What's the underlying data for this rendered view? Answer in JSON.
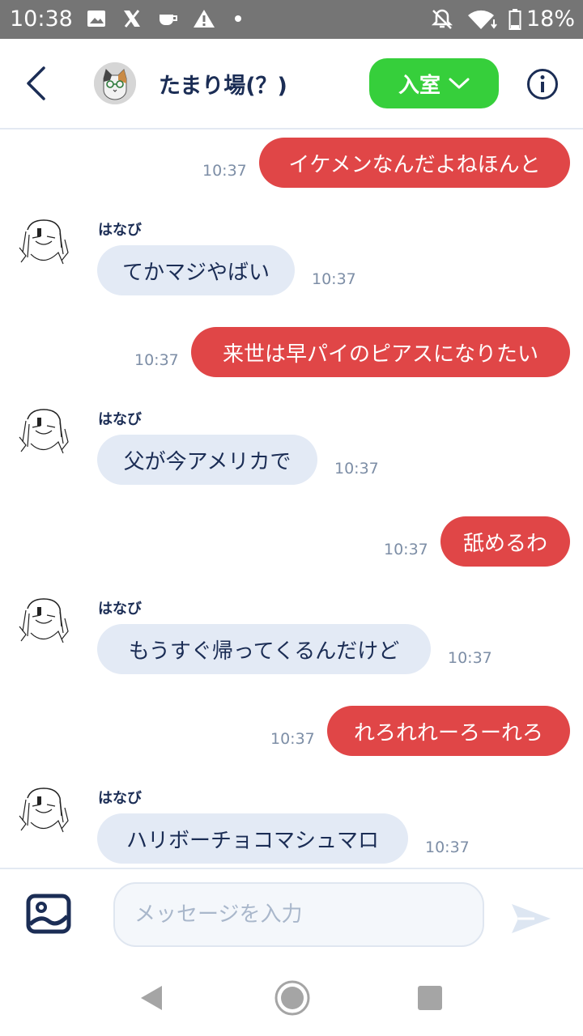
{
  "status_bar": {
    "time": "10:38",
    "battery": "18%"
  },
  "header": {
    "room_title": "たまり場(？)",
    "enter_button": "入室"
  },
  "messages": [
    {
      "side": "me",
      "text": "イケメンなんだよねほんと",
      "time": "10:37"
    },
    {
      "side": "other",
      "sender": "はなび",
      "text": "てかマジやばい",
      "time": "10:37"
    },
    {
      "side": "me",
      "text": "来世は早パイのピアスになりたい",
      "time": "10:37"
    },
    {
      "side": "other",
      "sender": "はなび",
      "text": "父が今アメリカで",
      "time": "10:37"
    },
    {
      "side": "me",
      "text": "舐めるわ",
      "time": "10:37"
    },
    {
      "side": "other",
      "sender": "はなび",
      "text": "もうすぐ帰ってくるんだけど",
      "time": "10:37"
    },
    {
      "side": "me",
      "text": "れろれれーろーれろ",
      "time": "10:37"
    },
    {
      "side": "other",
      "sender": "はなび",
      "text": "ハリボーチョコマシュマロ",
      "time": "10:37"
    }
  ],
  "composer": {
    "placeholder": "メッセージを入力"
  },
  "colors": {
    "my_bubble": "#e04647",
    "other_bubble": "#e3eaf5",
    "enter_button": "#36cf3b",
    "navy": "#1b2d55"
  },
  "icons": [
    "back-chevron-icon",
    "room-avatar-cat-icon",
    "chevron-down-icon",
    "info-icon",
    "image-icon",
    "send-icon"
  ]
}
